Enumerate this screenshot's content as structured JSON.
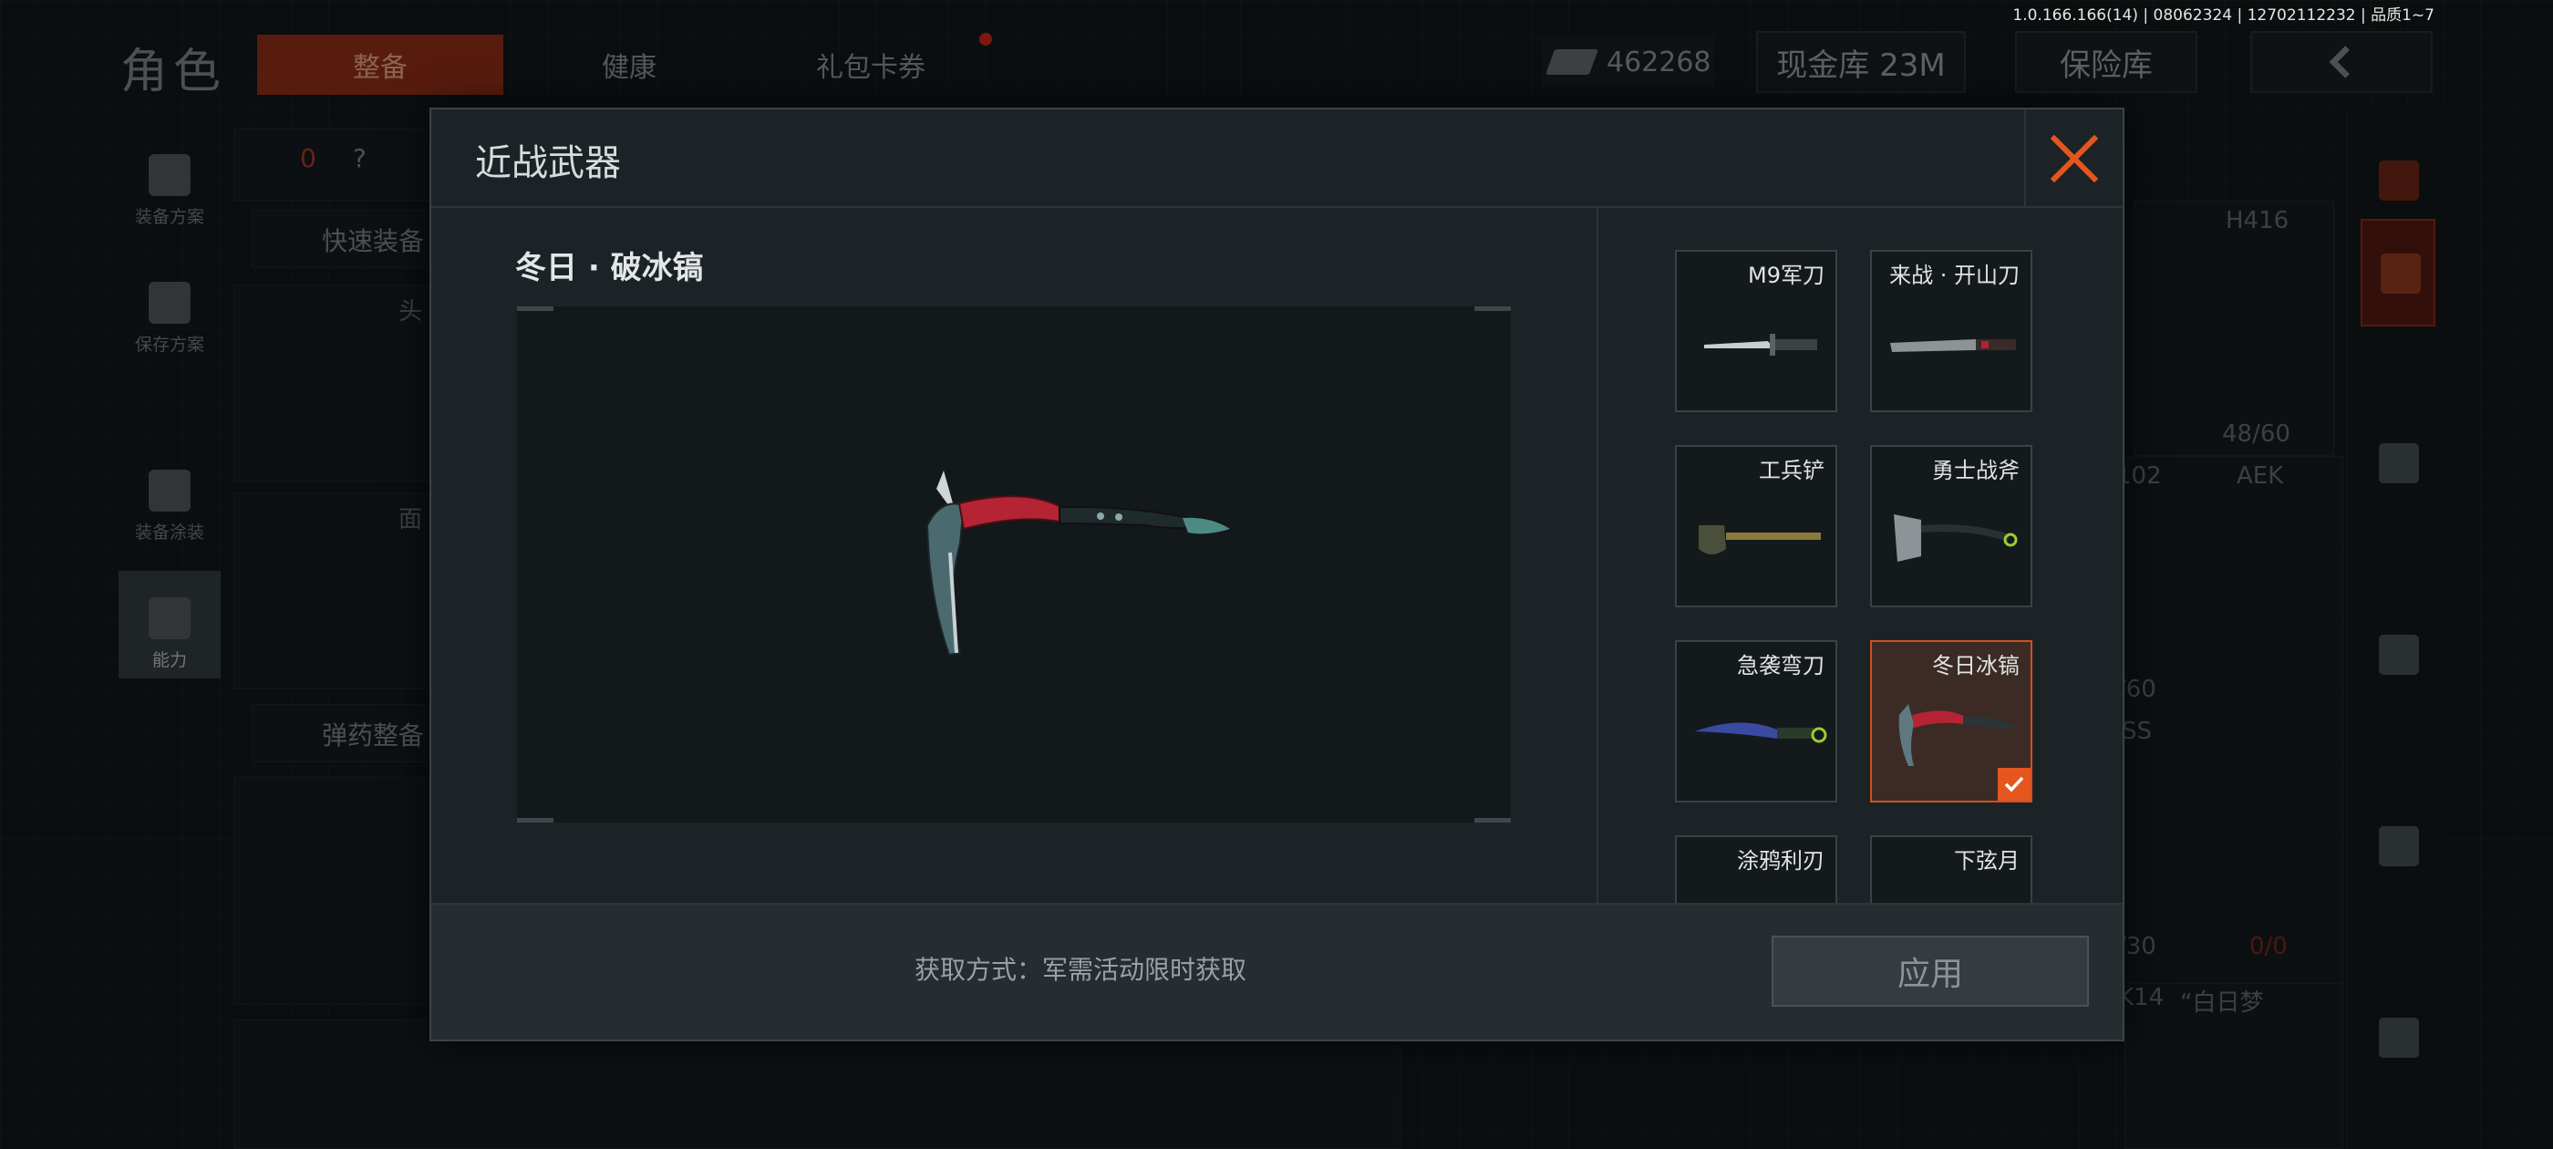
{
  "version_text": "1.0.166.166(14) | 08062324 | 12702112232 | 品质1~7",
  "topbar": {
    "title": "角色",
    "tabs": [
      {
        "label": "整备",
        "active": true
      },
      {
        "label": "健康",
        "active": false
      },
      {
        "label": "礼包卡券",
        "active": false
      }
    ],
    "currency_value": "462268",
    "cash_vault_label": "现金库 23M",
    "safe_label": "保险库"
  },
  "left_menu": {
    "items": [
      {
        "label": "装备方案"
      },
      {
        "label": "保存方案"
      },
      {
        "label": "装备涂装"
      },
      {
        "label": "能力",
        "active": true
      }
    ]
  },
  "background": {
    "loadout_count": "0",
    "help_mark": "?",
    "quick_equip_label": "快速装备",
    "ammo_label": "弹药整备",
    "slot_head_fragment": "头",
    "slot_face_fragment": "面",
    "weapon_primary": "H416",
    "ammo_primary": "48/60",
    "weapon_secondary": "AEK",
    "num_102": "102",
    "frag_60": "/60",
    "frag_ss": "SS",
    "frag_30": "/30",
    "frag_k14": "K14",
    "frag_zero_ratio": "0/0",
    "frag_dream": "“白日梦"
  },
  "modal": {
    "title": "近战武器",
    "selected_weapon_name": "冬日 · 破冰镐",
    "items": [
      {
        "label": "M9军刀",
        "icon": "combat-knife",
        "selected": false
      },
      {
        "label": "来战 · 开山刀",
        "icon": "machete",
        "selected": false
      },
      {
        "label": "工兵铲",
        "icon": "shovel",
        "selected": false
      },
      {
        "label": "勇士战斧",
        "icon": "axe",
        "selected": false
      },
      {
        "label": "急袭弯刀",
        "icon": "karambit",
        "selected": false
      },
      {
        "label": "冬日冰镐",
        "icon": "ice-pick",
        "selected": true
      },
      {
        "label": "涂鸦利刃",
        "icon": "blade",
        "selected": false
      },
      {
        "label": "下弦月",
        "icon": "crescent-blade",
        "selected": false
      }
    ],
    "acquire_text": "获取方式：军需活动限时获取",
    "apply_label": "应用"
  },
  "colors": {
    "accent": "#e5561f",
    "active_tab_bg": "#a1341a",
    "modal_bg": "#1c2326"
  }
}
